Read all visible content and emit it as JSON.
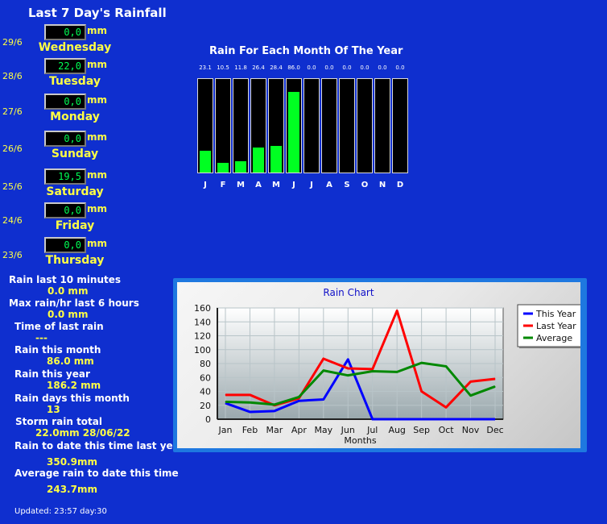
{
  "title": "Last 7 Day's Rainfall",
  "unit": "mm",
  "days": [
    {
      "date": "29/6",
      "value": "0,0",
      "day": "Wednesday"
    },
    {
      "date": "28/6",
      "value": "22,0",
      "day": "Tuesday"
    },
    {
      "date": "27/6",
      "value": "0,0",
      "day": "Monday"
    },
    {
      "date": "26/6",
      "value": "0,0",
      "day": "Sunday"
    },
    {
      "date": "25/6",
      "value": "19,5",
      "day": "Saturday"
    },
    {
      "date": "24/6",
      "value": "0,0",
      "day": "Friday"
    },
    {
      "date": "23/6",
      "value": "0,0",
      "day": "Thursday"
    }
  ],
  "stats": [
    {
      "label": "Rain last 10 minutes",
      "value": "0.0 mm"
    },
    {
      "label": "Max rain/hr last 6 hours",
      "value": "0.0 mm"
    },
    {
      "label": "Time of last rain",
      "value": "---"
    },
    {
      "label": "Rain this month",
      "value": "86.0 mm"
    },
    {
      "label": "Rain this year",
      "value": "186.2 mm"
    },
    {
      "label": "Rain days this month",
      "value": "13"
    },
    {
      "label": "Storm rain total",
      "value": "22.0mm 28/06/22"
    },
    {
      "label": "Rain to date this time last year",
      "value": "350.9mm"
    },
    {
      "label": "Average rain to date this time",
      "value": "243.7mm"
    }
  ],
  "updated": "Updated: 23:57 day:30",
  "month_bars": {
    "title": "Rain For Each Month Of The Year",
    "months": [
      "J",
      "F",
      "M",
      "A",
      "M",
      "J",
      "J",
      "A",
      "S",
      "O",
      "N",
      "D"
    ],
    "value_labels": [
      "23.1",
      "10.5",
      "11.8",
      "26.4",
      "28.4",
      "86.0",
      "0.0",
      "0.0",
      "0.0",
      "0.0",
      "0.0",
      "0.0"
    ],
    "values": [
      23.1,
      10.5,
      11.8,
      26.4,
      28.4,
      86.0,
      0,
      0,
      0,
      0,
      0,
      0
    ],
    "max": 100
  },
  "chart_data": {
    "type": "line",
    "title": "Rain Chart",
    "xlabel": "Months",
    "ylabel": "",
    "categories": [
      "Jan",
      "Feb",
      "Mar",
      "Apr",
      "May",
      "Jun",
      "Jul",
      "Aug",
      "Sep",
      "Oct",
      "Nov",
      "Dec"
    ],
    "ylim": [
      0,
      160
    ],
    "yticks": [
      0,
      20,
      40,
      60,
      80,
      100,
      120,
      140,
      160
    ],
    "grid": true,
    "legend_position": "top-right",
    "series": [
      {
        "name": "This Year",
        "color": "#0000ff",
        "values": [
          23.1,
          10.5,
          11.8,
          26.4,
          28.4,
          86.0,
          0,
          0,
          0,
          0,
          0,
          0
        ]
      },
      {
        "name": "Last Year",
        "color": "#ff0000",
        "values": [
          35,
          35,
          20,
          30,
          87,
          73,
          72,
          156,
          40,
          17,
          54,
          58
        ]
      },
      {
        "name": "Average",
        "color": "#008800",
        "values": [
          25,
          24,
          21,
          32,
          70,
          63,
          69,
          68,
          81,
          76,
          34,
          47
        ]
      }
    ]
  }
}
